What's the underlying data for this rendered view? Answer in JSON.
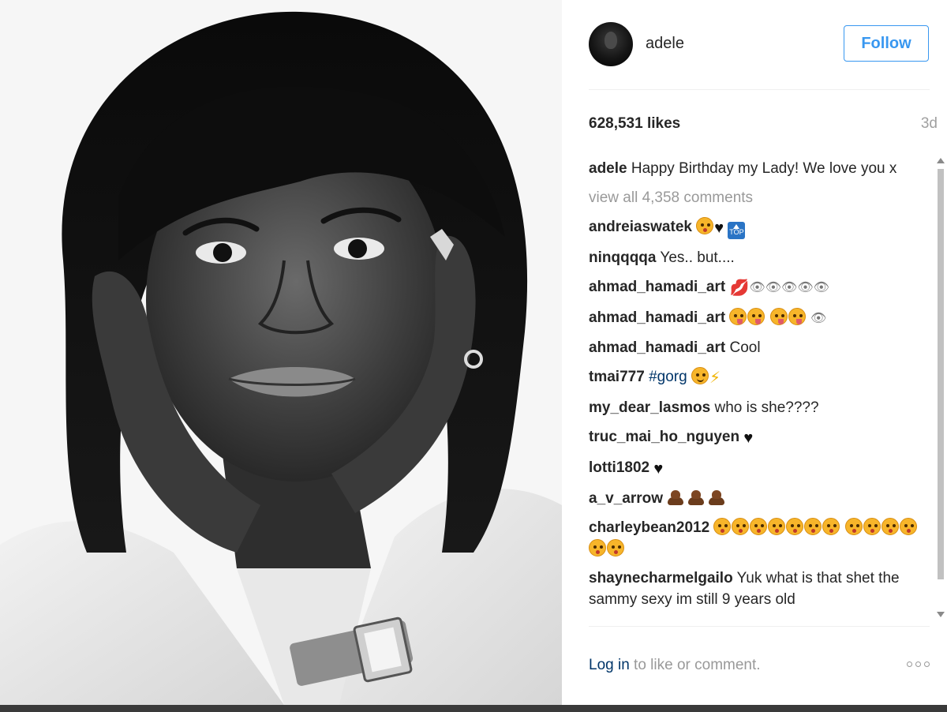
{
  "post": {
    "username": "adele",
    "follow_label": "Follow",
    "likes": "628,531 likes",
    "age": "3d",
    "caption_user": "adele",
    "caption_text": "Happy Birthday my Lady! We love you x",
    "view_all": "view all 4,358 comments"
  },
  "comments": [
    {
      "user": "andreiaswatek",
      "text": "",
      "icons": [
        "kiss-emoji",
        "black-heart",
        "top-sign"
      ]
    },
    {
      "user": "ninqqqqa",
      "text": "Yes.. but....",
      "icons": []
    },
    {
      "user": "ahmad_hamadi_art",
      "text": "",
      "icons": [
        "lips",
        "eyes",
        "eyes",
        "eyes",
        "eyes",
        "eyes"
      ]
    },
    {
      "user": "ahmad_hamadi_art",
      "text": "",
      "icons": [
        "tongue-emoji",
        "tongue-emoji",
        "tongue-emoji",
        "tongue-emoji",
        "eyes"
      ]
    },
    {
      "user": "ahmad_hamadi_art",
      "text": "Cool",
      "icons": []
    },
    {
      "user": "tmai777",
      "text": "#gorg",
      "icons": [
        "smile-emoji",
        "lightning"
      ]
    },
    {
      "user": "my_dear_lasmos",
      "text": "who is she????",
      "icons": []
    },
    {
      "user": "truc_mai_ho_nguyen",
      "text": "",
      "icons": [
        "black-heart"
      ]
    },
    {
      "user": "lotti1802",
      "text": "",
      "icons": [
        "black-heart"
      ]
    },
    {
      "user": "a_v_arrow",
      "text": "",
      "icons": [
        "poop",
        "poop",
        "poop"
      ]
    },
    {
      "user": "charleybean2012",
      "text": "",
      "icons": [
        "kiss-emoji x13"
      ]
    },
    {
      "user": "shaynecharmelgailo",
      "text": "Yuk what is that shet the sammy sexy im still 9 years old",
      "icons": []
    }
  ],
  "footer": {
    "login_label": "Log in",
    "rest": " to like or comment."
  },
  "colors": {
    "accent": "#3897f0",
    "link": "#003569",
    "muted": "#999999",
    "text": "#262626"
  }
}
